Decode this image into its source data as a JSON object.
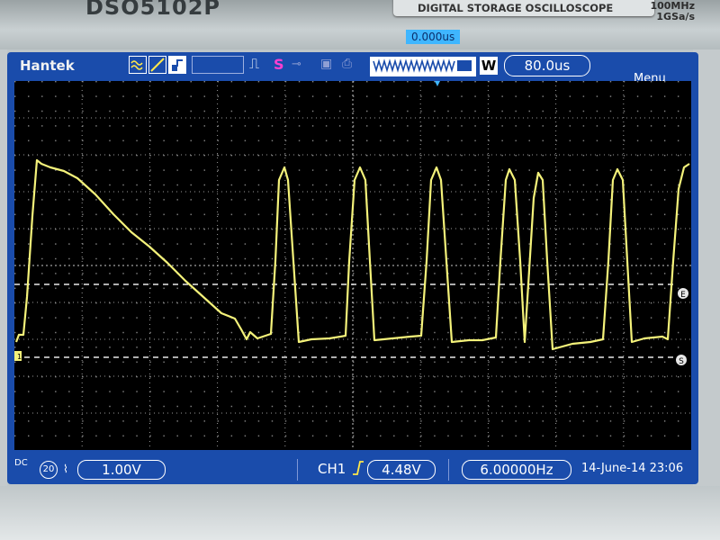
{
  "device": {
    "model_partial": "DSO5102P",
    "title": "DIGITAL STORAGE OSCILLOSCOPE",
    "spec_bandwidth": "100MHz",
    "spec_rate": "1GSa/s"
  },
  "topbar": {
    "brand": "Hantek",
    "s_label": "S",
    "w_badge": "W",
    "timebase": "80.0us",
    "menu": "Menu",
    "trigger_position": "0.000us"
  },
  "markers": {
    "ch1": "1",
    "trigger_level": "E",
    "s_marker": "S"
  },
  "bottombar": {
    "coupling": "DC",
    "bw_limit": "20",
    "ch1_volts_div": "1.00V",
    "trigger_channel": "CH1",
    "trigger_level": "4.48V",
    "frequency": "6.00000Hz",
    "datetime": "14-June-14 23:06"
  },
  "colors": {
    "screen_blue": "#1a4cab",
    "trace_yellow": "#f4f27a",
    "grid_dots": "#a0a0a0"
  },
  "icons": [
    "trigger-edge-icon",
    "key-icon",
    "disk-icon",
    "print-icon",
    "wave-icon",
    "ramp-icon",
    "square-icon"
  ]
}
